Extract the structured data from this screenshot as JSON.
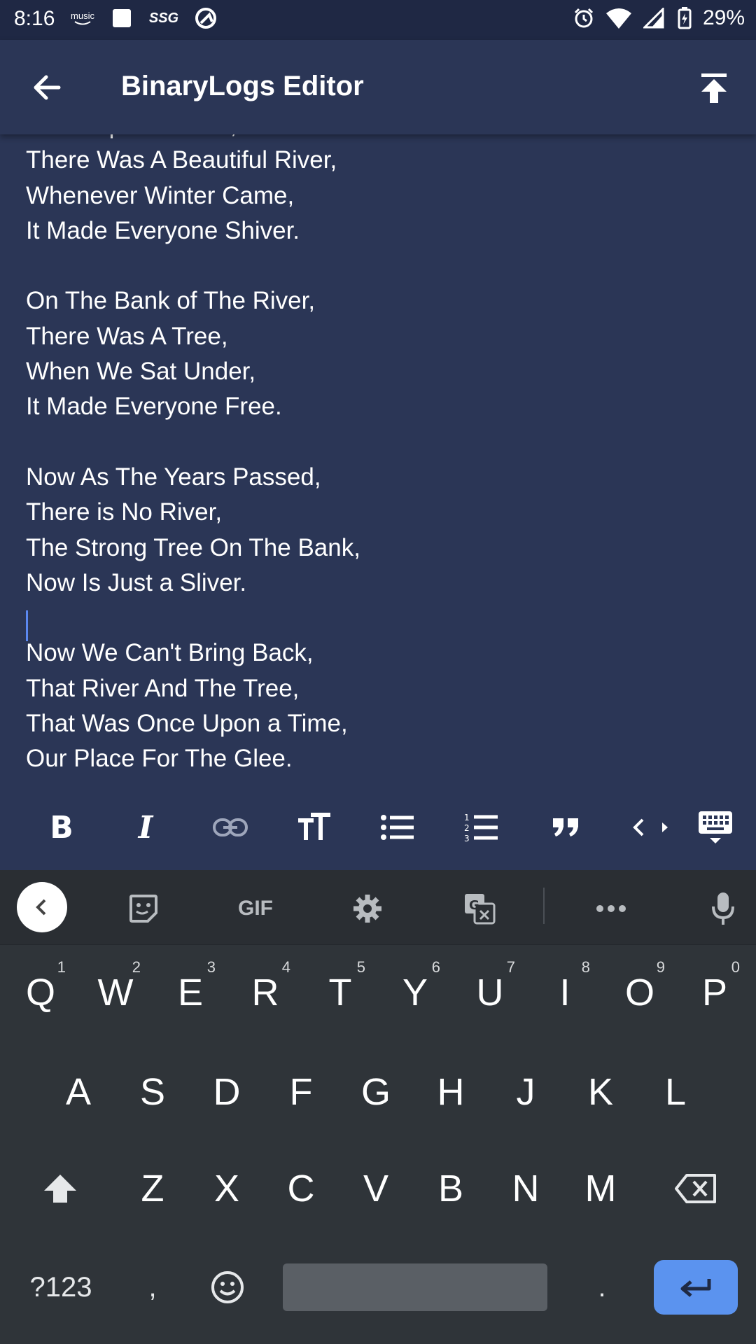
{
  "status_bar": {
    "time": "8:16",
    "battery": "29%",
    "left_icons": [
      "amazon-music-icon",
      "square-icon",
      "ssg-icon",
      "sync-icon"
    ],
    "right_icons": [
      "alarm-icon",
      "wifi-icon",
      "signal-icon",
      "battery-icon"
    ],
    "left_labels": {
      "music": "music",
      "ssg": "SSG"
    }
  },
  "app_bar": {
    "title": "BinaryLogs Editor",
    "back_icon": "arrow-left-icon",
    "action_icon": "upload-top-icon"
  },
  "editor": {
    "lines": [
      "Once Upon a Time,",
      "There Was A Beautiful River,",
      "Whenever Winter Came,",
      "It Made Everyone Shiver.",
      "",
      "On The Bank of The River,",
      "There Was A Tree,",
      "When We Sat Under,",
      "It Made Everyone Free.",
      "",
      "Now As The Years Passed,",
      "There is No River,",
      "The Strong Tree On The Bank,",
      "Now Is Just a Sliver.",
      "",
      "Now We Can't Bring Back,",
      "That River And The Tree,",
      "That Was Once Upon a Time,",
      "Our Place For The Glee."
    ]
  },
  "toolbar": {
    "buttons": [
      "bold",
      "italic",
      "link",
      "text-size",
      "bullet-list",
      "numbered-list",
      "quote",
      "code",
      "hide-keyboard"
    ],
    "bold_label": "B",
    "italic_label": "I"
  },
  "keyboard": {
    "strip": {
      "gif_label": "GIF",
      "icons": [
        "chevron-left-icon",
        "sticker-icon",
        "gif-icon",
        "settings-icon",
        "translate-icon",
        "more-icon",
        "microphone-icon"
      ]
    },
    "row1": [
      {
        "key": "Q",
        "num": "1"
      },
      {
        "key": "W",
        "num": "2"
      },
      {
        "key": "E",
        "num": "3"
      },
      {
        "key": "R",
        "num": "4"
      },
      {
        "key": "T",
        "num": "5"
      },
      {
        "key": "Y",
        "num": "6"
      },
      {
        "key": "U",
        "num": "7"
      },
      {
        "key": "I",
        "num": "8"
      },
      {
        "key": "O",
        "num": "9"
      },
      {
        "key": "P",
        "num": "0"
      }
    ],
    "row2": [
      "A",
      "S",
      "D",
      "F",
      "G",
      "H",
      "J",
      "K",
      "L"
    ],
    "row3": [
      "Z",
      "X",
      "C",
      "V",
      "B",
      "N",
      "M"
    ],
    "symbols_label": "?123",
    "comma_label": ",",
    "period_label": "."
  },
  "colors": {
    "app_background": "#2b3656",
    "status_bar": "#1f2844",
    "keyboard_background": "#2f3439",
    "enter_key": "#5b93ef",
    "cursor": "#5b88f0"
  }
}
